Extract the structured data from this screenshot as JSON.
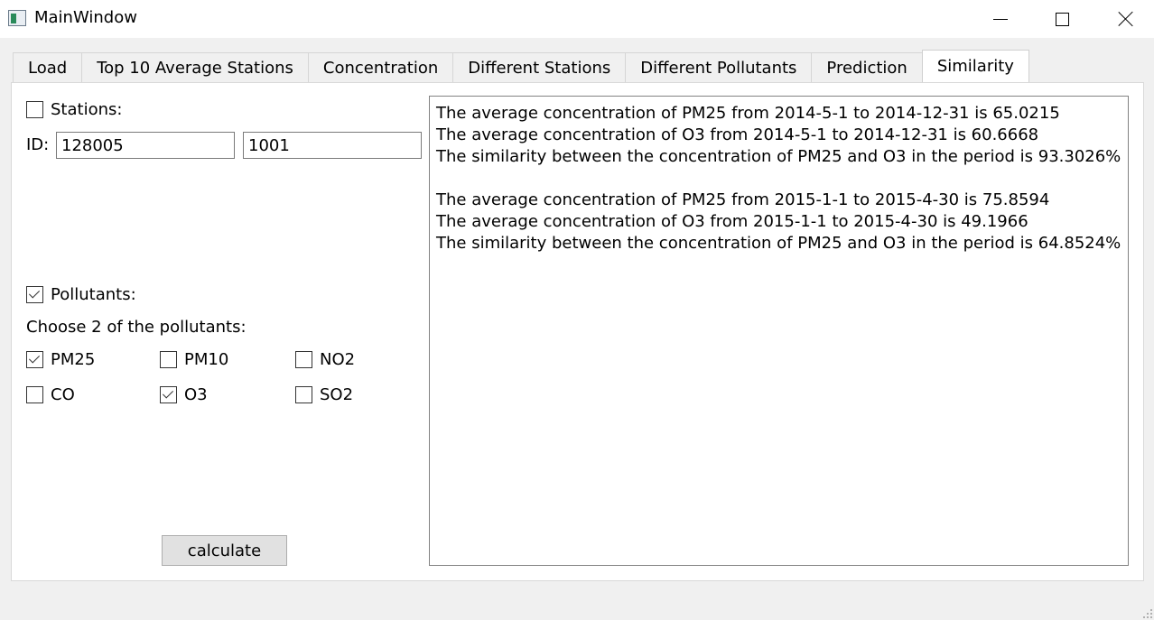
{
  "window": {
    "title": "MainWindow"
  },
  "tabs": [
    {
      "label": "Load",
      "active": false
    },
    {
      "label": "Top 10 Average Stations",
      "active": false
    },
    {
      "label": "Concentration",
      "active": false
    },
    {
      "label": "Different Stations",
      "active": false
    },
    {
      "label": "Different Pollutants",
      "active": false
    },
    {
      "label": "Prediction",
      "active": false
    },
    {
      "label": "Similarity",
      "active": true
    }
  ],
  "stations": {
    "label": "Stations:",
    "checked": false,
    "id_label": "ID:",
    "id1": "128005",
    "id2": "1001"
  },
  "pollutants": {
    "label": "Pollutants:",
    "checked": true,
    "choose_label": "Choose 2 of the pollutants:",
    "items": [
      {
        "label": "PM25",
        "checked": true
      },
      {
        "label": "PM10",
        "checked": false
      },
      {
        "label": "NO2",
        "checked": false
      },
      {
        "label": "CO",
        "checked": false
      },
      {
        "label": "O3",
        "checked": true
      },
      {
        "label": "SO2",
        "checked": false
      }
    ]
  },
  "calculate_label": "calculate",
  "output": {
    "lines": [
      "The average concentration of PM25 from 2014-5-1 to 2014-12-31 is 65.0215",
      "The average concentration of O3 from 2014-5-1 to 2014-12-31 is 60.6668",
      "The similarity between the concentration of PM25 and O3 in the period is 93.3026%",
      "",
      "The average concentration of PM25 from 2015-1-1 to 2015-4-30 is 75.8594",
      "The average concentration of O3 from 2015-1-1 to 2015-4-30 is 49.1966",
      "The similarity between the concentration of PM25 and O3 in the period is 64.8524%"
    ]
  }
}
